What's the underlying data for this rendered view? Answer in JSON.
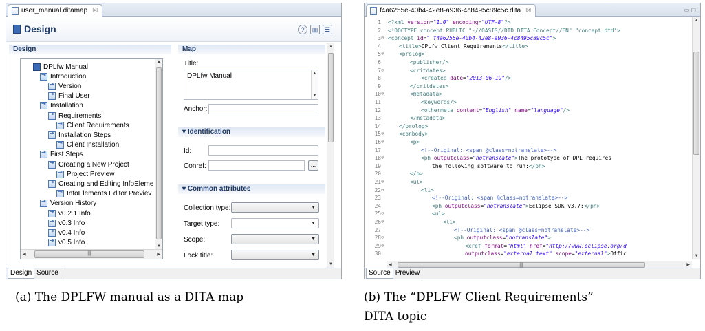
{
  "left": {
    "tab_title": "user_manual.ditamap",
    "tab_close": "☒",
    "header_title": "Design",
    "header_buttons": [
      "?",
      "▥",
      "☰"
    ],
    "design_section": "Design",
    "tree": [
      {
        "label": "DPLfw Manual",
        "level": 0,
        "root": true
      },
      {
        "label": "Introduction",
        "level": 1
      },
      {
        "label": "Version",
        "level": 2
      },
      {
        "label": "Final User",
        "level": 2
      },
      {
        "label": "Installation",
        "level": 1
      },
      {
        "label": "Requirements",
        "level": 2
      },
      {
        "label": "Client Requirements",
        "level": 3
      },
      {
        "label": "Installation Steps",
        "level": 2
      },
      {
        "label": "Client Installation",
        "level": 3
      },
      {
        "label": "First Steps",
        "level": 1
      },
      {
        "label": "Creating a New Project",
        "level": 2
      },
      {
        "label": "Project Preview",
        "level": 3
      },
      {
        "label": "Creating and Editing InfoEleme",
        "level": 2
      },
      {
        "label": "InfoElements Editor Previev",
        "level": 3
      },
      {
        "label": "Version History",
        "level": 1
      },
      {
        "label": "v0.2.1 Info",
        "level": 2
      },
      {
        "label": "v0.3 Info",
        "level": 2
      },
      {
        "label": "v0.4 Info",
        "level": 2
      },
      {
        "label": "v0.5 Info",
        "level": 2
      }
    ],
    "map_section": "Map",
    "title_label": "Title:",
    "title_value": "DPLfw Manual",
    "anchor_label": "Anchor:",
    "identification_section": "Identification",
    "id_label": "Id:",
    "conref_label": "Conref:",
    "conref_button": "...",
    "common_section": "Common attributes",
    "collection_label": "Collection type:",
    "target_label": "Target type:",
    "scope_label": "Scope:",
    "lock_label": "Lock title:",
    "bottom_tabs": [
      "Design",
      "Source"
    ]
  },
  "right": {
    "tab_title": "f4a6255e-40b4-42e8-a936-4c8495c89c5c.dita",
    "tab_close": "☒",
    "window_controls": "▭ ▢",
    "bottom_tabs": [
      "Source",
      "Preview"
    ],
    "lines": [
      {
        "n": "1",
        "fold": "",
        "html": "<span class='t-pi'>&lt;?xml</span> <span class='t-attr'>version</span>=<span class='t-val'>\"1.0\"</span> <span class='t-attr'>encoding</span>=<span class='t-val'>\"UTF-8\"</span><span class='t-pi'>?&gt;</span>",
        "indent": 0
      },
      {
        "n": "2",
        "fold": "",
        "html": "<span class='t-pi'>&lt;!DOCTYPE concept PUBLIC \"-//OASIS//DTD DITA Concept//EN\" \"concept.dtd\"&gt;</span>",
        "indent": 0
      },
      {
        "n": "3",
        "fold": "⊖",
        "html": "<span class='t-tag'>&lt;concept</span> <span class='t-attr'>id</span>=<span class='t-val'>\"_f4a6255e-40b4-42e8-a936-4c8495c89c5c\"</span><span class='t-tag'>&gt;</span>",
        "indent": 0
      },
      {
        "n": "4",
        "fold": "",
        "html": "<span class='t-tag'>&lt;title&gt;</span><span class='t-txt'>DPLfw Client Requirements</span><span class='t-tag'>&lt;/title&gt;</span>",
        "indent": 1
      },
      {
        "n": "5",
        "fold": "⊖",
        "html": "<span class='t-tag'>&lt;prolog&gt;</span>",
        "indent": 1
      },
      {
        "n": "6",
        "fold": "",
        "html": "<span class='t-tag'>&lt;publisher/&gt;</span>",
        "indent": 2
      },
      {
        "n": "7",
        "fold": "⊖",
        "html": "<span class='t-tag'>&lt;critdates&gt;</span>",
        "indent": 2
      },
      {
        "n": "8",
        "fold": "",
        "html": "<span class='t-tag'>&lt;created</span> <span class='t-attr'>date</span>=<span class='t-val'>\"2013-06-19\"</span><span class='t-tag'>/&gt;</span>",
        "indent": 3
      },
      {
        "n": "9",
        "fold": "",
        "html": "<span class='t-tag'>&lt;/critdates&gt;</span>",
        "indent": 2
      },
      {
        "n": "10",
        "fold": "⊖",
        "html": "<span class='t-tag'>&lt;metadata&gt;</span>",
        "indent": 2
      },
      {
        "n": "11",
        "fold": "",
        "html": "<span class='t-tag'>&lt;keywords/&gt;</span>",
        "indent": 3
      },
      {
        "n": "12",
        "fold": "",
        "html": "<span class='t-tag'>&lt;othermeta</span> <span class='t-attr'>content</span>=<span class='t-val'>\"English\"</span> <span class='t-attr'>name</span>=<span class='t-val'>\"language\"</span><span class='t-tag'>/&gt;</span>",
        "indent": 3
      },
      {
        "n": "13",
        "fold": "",
        "html": "<span class='t-tag'>&lt;/metadata&gt;</span>",
        "indent": 2
      },
      {
        "n": "14",
        "fold": "",
        "html": "<span class='t-tag'>&lt;/prolog&gt;</span>",
        "indent": 1
      },
      {
        "n": "15",
        "fold": "⊖",
        "html": "<span class='t-tag'>&lt;conbody&gt;</span>",
        "indent": 1
      },
      {
        "n": "16",
        "fold": "⊖",
        "html": "<span class='t-tag'>&lt;p&gt;</span>",
        "indent": 2
      },
      {
        "n": "17",
        "fold": "",
        "html": "<span class='t-com'>&lt;!--Original: &lt;span @class=notranslate&gt;--&gt;</span>",
        "indent": 3
      },
      {
        "n": "18",
        "fold": "⊖",
        "html": "<span class='t-tag'>&lt;ph</span> <span class='t-attr'>outputclass</span>=<span class='t-val'>\"notranslate\"</span><span class='t-tag'>&gt;</span><span class='t-txt'>The prototype of DPL requires</span>",
        "indent": 3
      },
      {
        "n": "19",
        "fold": "",
        "html": "<span class='t-txt'>the following software to run:</span><span class='t-tag'>&lt;/ph&gt;</span>",
        "indent": 4
      },
      {
        "n": "20",
        "fold": "",
        "html": "<span class='t-tag'>&lt;/p&gt;</span>",
        "indent": 2
      },
      {
        "n": "21",
        "fold": "⊖",
        "html": "<span class='t-tag'>&lt;ul&gt;</span>",
        "indent": 2
      },
      {
        "n": "22",
        "fold": "⊖",
        "html": "<span class='t-tag'>&lt;li&gt;</span>",
        "indent": 3
      },
      {
        "n": "23",
        "fold": "",
        "html": "<span class='t-com'>&lt;!--Original: &lt;span @class=notranslate&gt;--&gt;</span>",
        "indent": 4
      },
      {
        "n": "24",
        "fold": "",
        "html": "<span class='t-tag'>&lt;ph</span> <span class='t-attr'>outputclass</span>=<span class='t-val'>\"notranslate\"</span><span class='t-tag'>&gt;</span><span class='t-txt'>Eclipse SDK v3.7:</span><span class='t-tag'>&lt;/ph&gt;</span>",
        "indent": 4
      },
      {
        "n": "25",
        "fold": "⊖",
        "html": "<span class='t-tag'>&lt;ul&gt;</span>",
        "indent": 4
      },
      {
        "n": "26",
        "fold": "⊖",
        "html": "<span class='t-tag'>&lt;li&gt;</span>",
        "indent": 5
      },
      {
        "n": "27",
        "fold": "",
        "html": "<span class='t-com'>&lt;!--Original: &lt;span @class=notranslate&gt;--&gt;</span>",
        "indent": 6
      },
      {
        "n": "28",
        "fold": "⊖",
        "html": "<span class='t-tag'>&lt;ph</span> <span class='t-attr'>outputclass</span>=<span class='t-val'>\"notranslate\"</span><span class='t-tag'>&gt;</span>",
        "indent": 6
      },
      {
        "n": "29",
        "fold": "⊖",
        "html": "<span class='t-tag'>&lt;xref</span> <span class='t-attr'>format</span>=<span class='t-val'>\"html\"</span> <span class='t-attr'>href</span>=<span class='t-val'>\"http://www.eclipse.org/d</span>",
        "indent": 7
      },
      {
        "n": "30",
        "fold": "",
        "html": "<span class='t-attr'>outputclass</span>=<span class='t-val'>\"external text\"</span> <span class='t-attr'>scope</span>=<span class='t-val'>\"external\"</span><span class='t-tag'>&gt;</span><span class='t-txt'>Offic</span>",
        "indent": 7
      }
    ]
  },
  "captions": {
    "a": "(a) The DPLFW manual as a DITA map",
    "b_line1": "(b)   The  “DPLFW  Client  Requirements”",
    "b_line2": "DITA topic"
  }
}
